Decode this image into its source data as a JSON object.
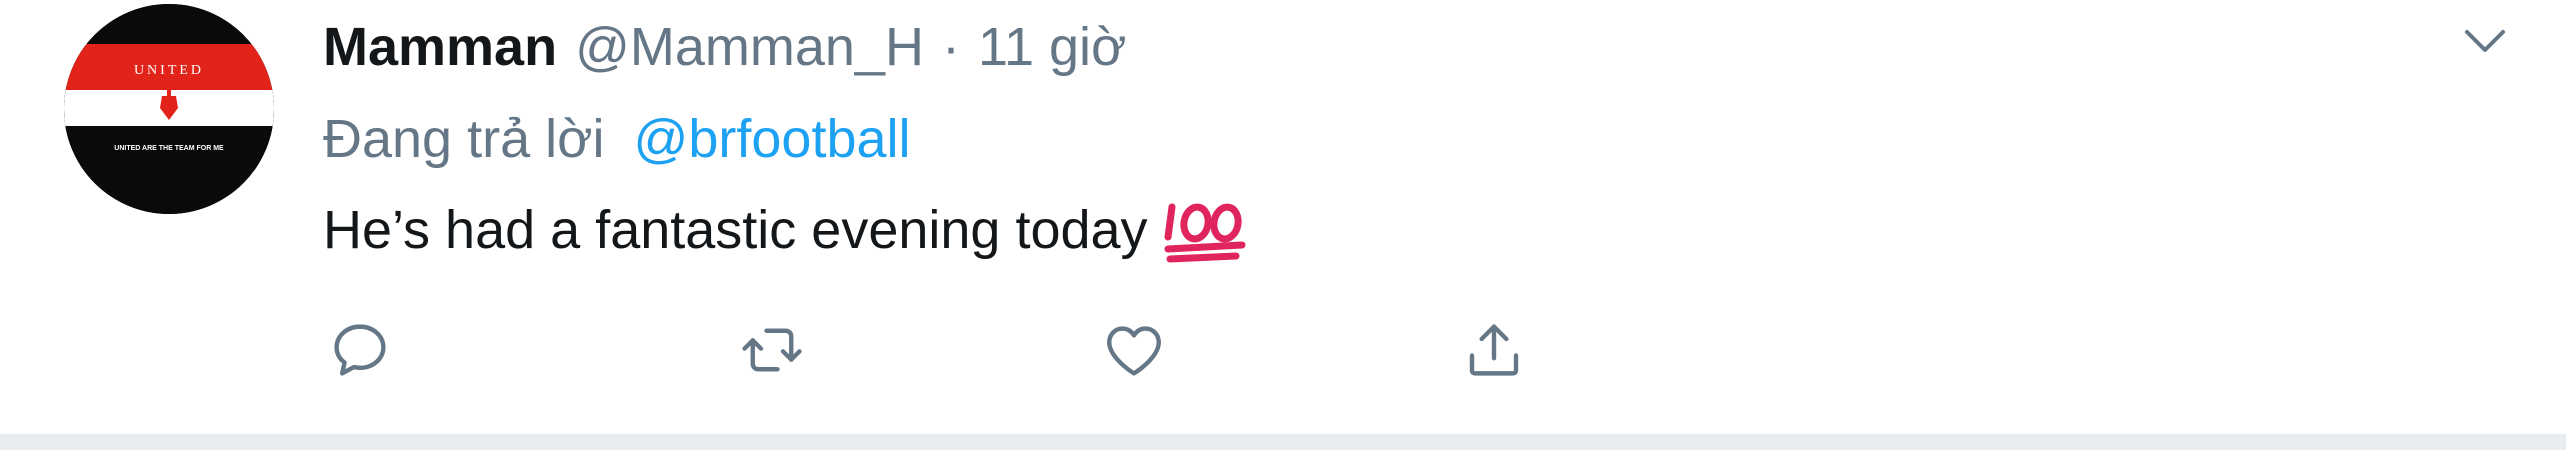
{
  "tweet": {
    "display_name": "Mamman",
    "handle": "@Mamman_H",
    "separator": "·",
    "time": "11 giờ",
    "reply_prefix": "Đang trả lời",
    "reply_to": "@brfootball",
    "text": "He’s had a fantastic evening today",
    "emoji": "💯"
  },
  "avatar": {
    "top_text": "UNITED",
    "bottom_text": "UNITED ARE THE TEAM FOR ME",
    "colors": {
      "red": "#e2231a",
      "white": "#ffffff",
      "black": "#0a0a0a"
    }
  },
  "icons": {
    "caret": "chevron-down-icon",
    "reply": "reply-icon",
    "retweet": "retweet-icon",
    "like": "heart-icon",
    "share": "share-icon"
  },
  "colors": {
    "text_primary": "#14171a",
    "text_secondary": "#657786",
    "link": "#1da1f2",
    "icon": "#657786",
    "divider": "#e9edef"
  }
}
